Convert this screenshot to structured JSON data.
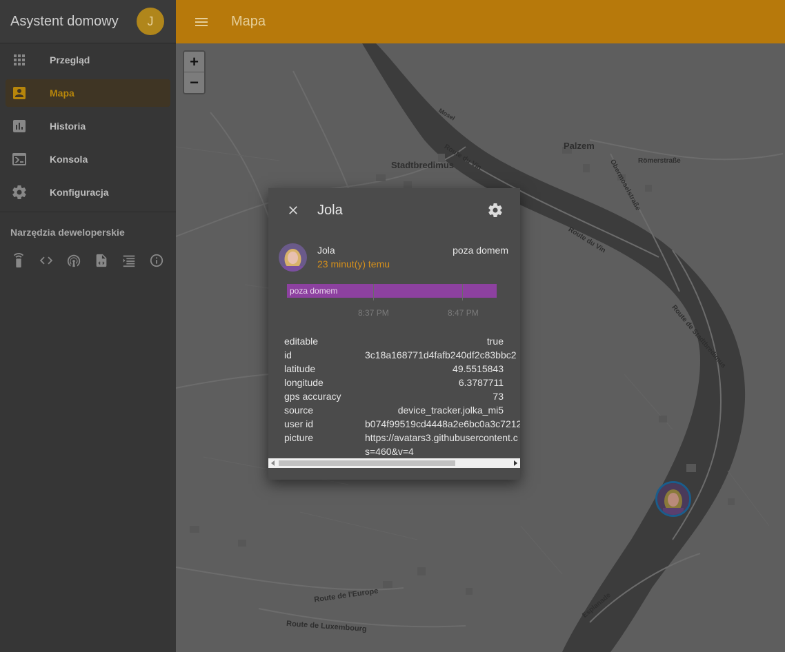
{
  "sidebar": {
    "title": "Asystent domowy",
    "user_initial": "J",
    "items": [
      {
        "label": "Przegląd",
        "icon": "apps-grid-icon"
      },
      {
        "label": "Mapa",
        "icon": "account-box-icon",
        "active": true
      },
      {
        "label": "Historia",
        "icon": "chart-box-icon"
      },
      {
        "label": "Konsola",
        "icon": "console-icon"
      },
      {
        "label": "Konfiguracja",
        "icon": "gear-icon"
      }
    ],
    "dev_tools_title": "Narzędzia deweloperskie",
    "dev_tools": [
      "remote-icon",
      "code-icon",
      "broadcast-icon",
      "file-code-icon",
      "template-icon",
      "info-icon"
    ]
  },
  "topbar": {
    "title": "Mapa"
  },
  "map": {
    "zoom_in": "+",
    "zoom_out": "−",
    "labels": {
      "palzem": "Palzem",
      "stadtbredimus": "Stadtbredimus",
      "route_du_vin_1": "Route du Vin",
      "route_du_vin_2": "Route du Vin",
      "romerstrasse": "Römerstraße",
      "obermoselstrasse": "Obermoselstraße",
      "route_de_stadtbredimus": "Route de Stadtbredimus",
      "route_de_leurope": "Route de l'Europe",
      "route_de_luxembourg": "Route de Luxembourg",
      "esplanade": "Esplanade",
      "mosel": "Mosel"
    }
  },
  "dialog": {
    "title": "Jola",
    "entity": {
      "name": "Jola",
      "last_changed": "23 minut(y) temu",
      "state": "poza domem"
    },
    "timeline": {
      "bar_label": "poza domem",
      "ticks": [
        "8:37 PM",
        "8:47 PM"
      ]
    },
    "attributes": [
      {
        "key": "editable",
        "value": "true",
        "align": "right"
      },
      {
        "key": "id",
        "value": "3c18a168771d4fafb240df2c83bbc2",
        "align": "left"
      },
      {
        "key": "latitude",
        "value": "49.5515843",
        "align": "right"
      },
      {
        "key": "longitude",
        "value": "6.3787711",
        "align": "right"
      },
      {
        "key": "gps accuracy",
        "value": "73",
        "align": "right"
      },
      {
        "key": "source",
        "value": "device_tracker.jolka_mi5",
        "align": "right"
      },
      {
        "key": "user id",
        "value": "b074f99519cd4448a2e6bc0a3c7212",
        "align": "left"
      },
      {
        "key": "picture",
        "value": "https://avatars3.githubusercontent.c",
        "align": "left"
      },
      {
        "key": "",
        "value": "s=460&v=4",
        "align": "left"
      }
    ]
  },
  "colors": {
    "accent": "#b7790b",
    "history_bar": "#8d41a0",
    "time_text": "#d6901b"
  }
}
